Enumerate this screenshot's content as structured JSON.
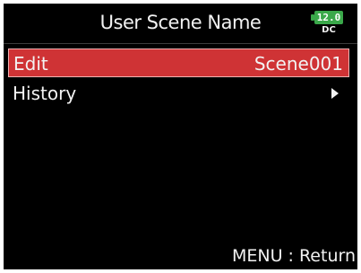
{
  "header": {
    "title": "User Scene Name",
    "battery": {
      "voltage": "12.0",
      "source": "DC",
      "color": "#3aa84a"
    }
  },
  "menu": {
    "items": [
      {
        "label": "Edit",
        "value": "Scene001",
        "selected": true,
        "highlight_color": "#cf3335"
      },
      {
        "label": "History",
        "icon": "triangle-right-icon",
        "selected": false
      }
    ]
  },
  "footer": {
    "hint": "MENU : Return"
  }
}
